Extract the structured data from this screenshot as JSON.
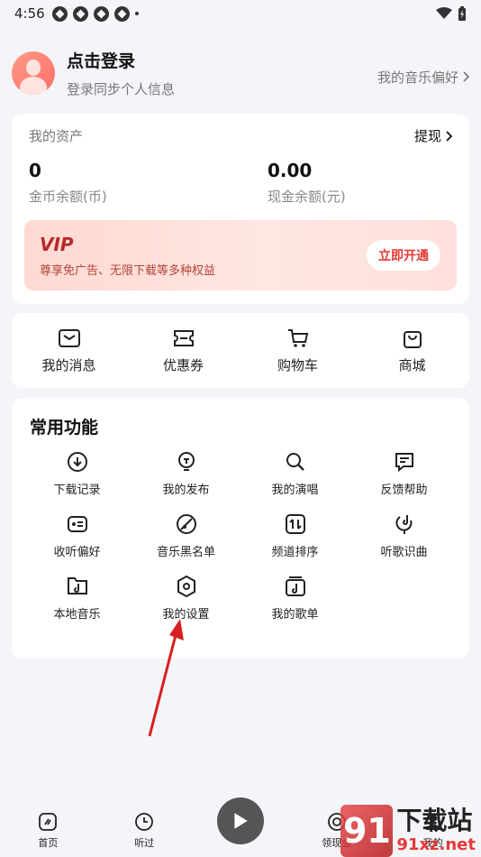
{
  "status": {
    "time": "4:56"
  },
  "profile": {
    "title": "点击登录",
    "subtitle": "登录同步个人信息",
    "pref_link": "我的音乐偏好"
  },
  "assets": {
    "label": "我的资产",
    "withdraw": "提现",
    "coin_value": "0",
    "coin_label": "金币余额(币)",
    "cash_value": "0.00",
    "cash_label": "现金余额(元)"
  },
  "vip": {
    "title": "VIP",
    "subtitle": "尊享免广告、无限下载等多种权益",
    "button": "立即开通"
  },
  "quick": [
    {
      "label": "我的消息",
      "icon": "message-icon"
    },
    {
      "label": "优惠券",
      "icon": "coupon-icon"
    },
    {
      "label": "购物车",
      "icon": "cart-icon"
    },
    {
      "label": "商城",
      "icon": "shop-icon"
    }
  ],
  "features": {
    "title": "常用功能",
    "items": [
      {
        "label": "下载记录",
        "icon": "download-icon"
      },
      {
        "label": "我的发布",
        "icon": "publish-icon"
      },
      {
        "label": "我的演唱",
        "icon": "sing-icon"
      },
      {
        "label": "反馈帮助",
        "icon": "feedback-icon"
      },
      {
        "label": "收听偏好",
        "icon": "preference-icon"
      },
      {
        "label": "音乐黑名单",
        "icon": "blacklist-icon"
      },
      {
        "label": "频道排序",
        "icon": "sort-icon"
      },
      {
        "label": "听歌识曲",
        "icon": "recognize-icon"
      },
      {
        "label": "本地音乐",
        "icon": "local-music-icon"
      },
      {
        "label": "我的设置",
        "icon": "settings-icon"
      },
      {
        "label": "我的歌单",
        "icon": "playlist-icon"
      }
    ]
  },
  "nav": [
    {
      "label": "首页",
      "icon": "home-icon"
    },
    {
      "label": "听过",
      "icon": "history-icon"
    },
    {
      "label": "领现金",
      "icon": "cash-icon"
    },
    {
      "label": "我的",
      "icon": "profile-icon"
    }
  ],
  "watermark": {
    "logo": "91",
    "title": "下载站",
    "url": "91xz.net"
  },
  "colors": {
    "accent": "#e53935",
    "background": "#f4f5f9"
  }
}
